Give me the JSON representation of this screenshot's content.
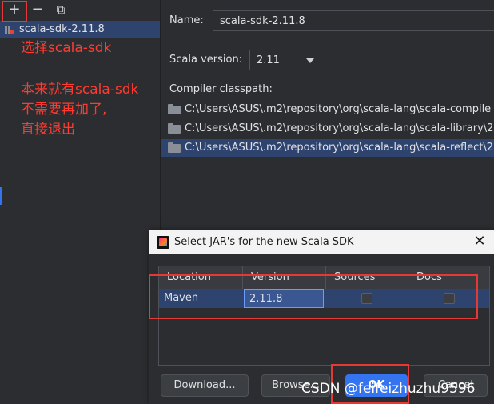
{
  "toolbar": {
    "add_icon": "+",
    "remove_icon": "−",
    "copy_icon": "⧉"
  },
  "left_list": {
    "items": [
      {
        "label": "scala-sdk-2.11.8"
      }
    ]
  },
  "annotations": {
    "line1": "选择scala-sdk",
    "line2": "本来就有scala-sdk",
    "line3": "不需要再加了,",
    "line4": "直接退出"
  },
  "details": {
    "name_label": "Name:",
    "name_value": "scala-sdk-2.11.8",
    "version_label": "Scala version:",
    "version_value": "2.11",
    "classpath_label": "Compiler classpath:",
    "classpath": [
      "C:\\Users\\ASUS\\.m2\\repository\\org\\scala-lang\\scala-compile",
      "C:\\Users\\ASUS\\.m2\\repository\\org\\scala-lang\\scala-library\\2",
      "C:\\Users\\ASUS\\.m2\\repository\\org\\scala-lang\\scala-reflect\\2"
    ]
  },
  "dialog": {
    "title": "Select JAR's for the new Scala SDK",
    "close_icon": "✕",
    "columns": [
      "Location",
      "Version",
      "Sources",
      "Docs"
    ],
    "rows": [
      {
        "location": "Maven",
        "version": "2.11.8",
        "sources": false,
        "docs": false
      }
    ],
    "buttons": {
      "download": "Download...",
      "browse": "Browse...",
      "ok": "OK",
      "cancel": "Cancel"
    }
  },
  "watermark": "CSDN @feifeizhuzhu9596",
  "colors": {
    "accent": "#3574f0",
    "selection": "#2e436e",
    "annotation_red": "#ff3b30"
  }
}
